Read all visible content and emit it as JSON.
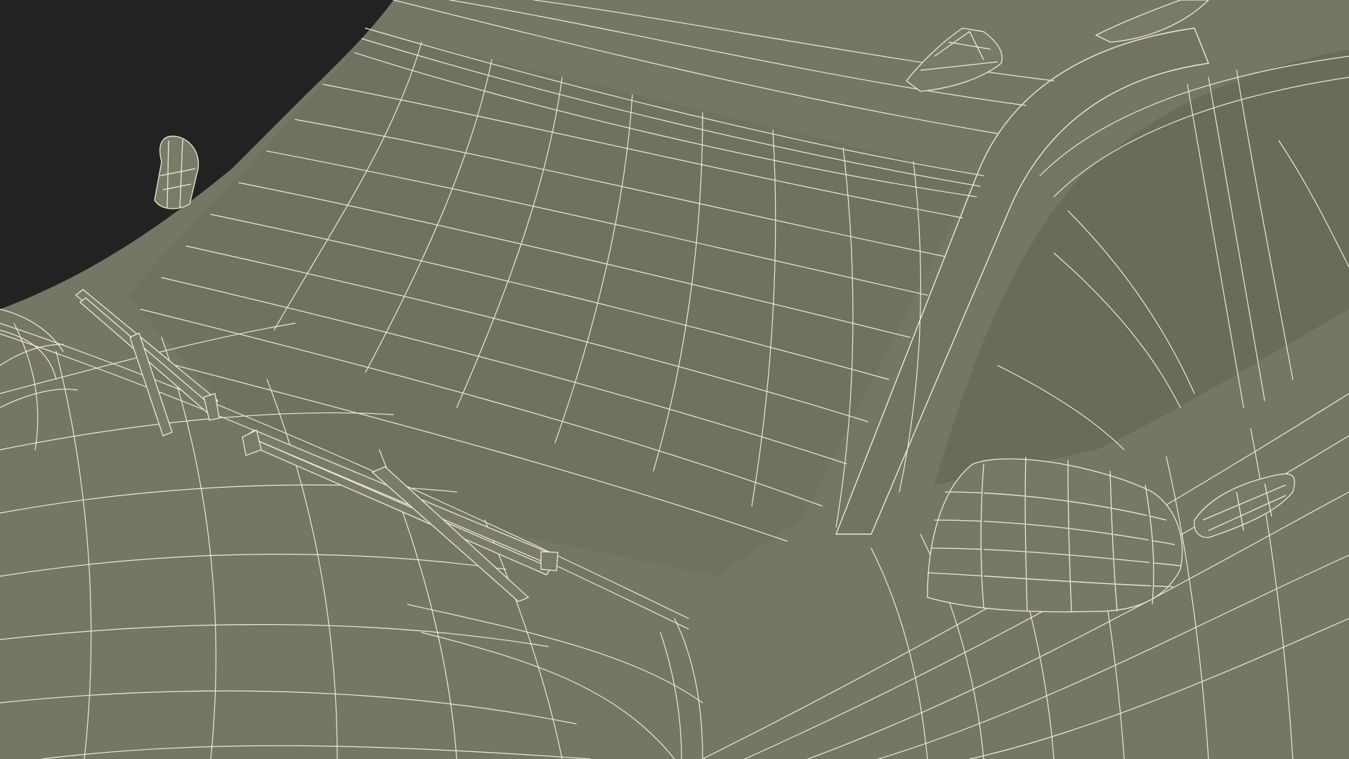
{
  "scene": {
    "subject": "",
    "colors": {
      "background": "#222222",
      "surface": "#767665",
      "surface_dark": "#6b6b5b",
      "glass": "#717161",
      "wire": "#ecebd8"
    }
  }
}
